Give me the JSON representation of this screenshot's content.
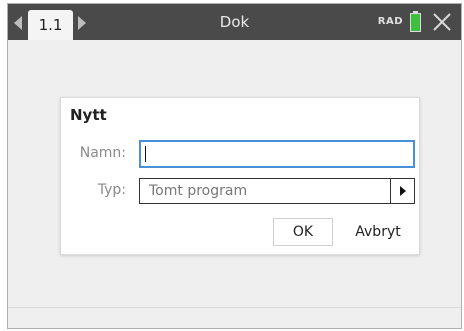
{
  "titlebar": {
    "tab_label": "1.1",
    "document_title": "Dok",
    "angle_mode": "RAD",
    "battery_color": "#3fbf3f"
  },
  "dialog": {
    "title": "Nytt",
    "name_label": "Namn:",
    "name_value": "",
    "type_label": "Typ:",
    "type_value": "Tomt program",
    "ok_label": "OK",
    "cancel_label": "Avbryt",
    "focus_color": "#4a90d9"
  },
  "icons": {
    "prev_tab": "chevron-left-icon",
    "next_tab": "chevron-right-icon",
    "battery": "battery-icon",
    "close": "close-icon",
    "dropdown": "caret-right-icon"
  }
}
